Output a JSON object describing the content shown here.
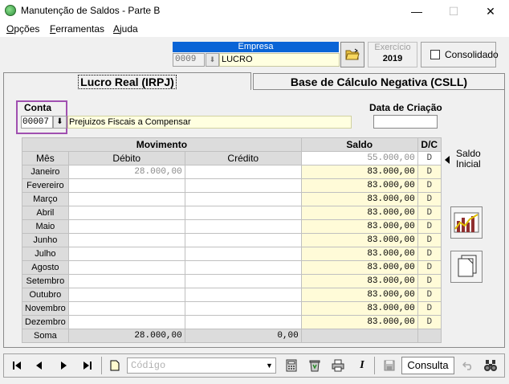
{
  "window": {
    "title": "Manutenção de Saldos - Parte B",
    "minimize": "—",
    "maximize": "☐",
    "close": "✕"
  },
  "menu": [
    {
      "first": "O",
      "rest": "pções"
    },
    {
      "first": "F",
      "rest": "erramentas"
    },
    {
      "first": "A",
      "rest": "juda"
    }
  ],
  "empresa": {
    "header": "Empresa",
    "code": "0009",
    "name": "LUCRO"
  },
  "exercicio": {
    "label": "Exercício",
    "value": "2019"
  },
  "consolidado": {
    "label": "Consolidado",
    "checked": false
  },
  "tabs": {
    "active": "Lucro Real (IRPJ)",
    "inactive": "Base de Cálculo Negativa (CSLL)"
  },
  "conta": {
    "label": "Conta",
    "code": "00007",
    "description": "Prejuizos Fiscais a Compensar"
  },
  "data_criacao": {
    "label": "Data de Criação",
    "value": ""
  },
  "table": {
    "headers": {
      "movimento": "Movimento",
      "saldo": "Saldo",
      "dc": "D/C",
      "mes": "Mês",
      "debito": "Débito",
      "credito": "Crédito"
    },
    "initial": {
      "debito": "",
      "credito": "",
      "saldo": "55.000,00",
      "dc": "D"
    },
    "rows": [
      {
        "mes": "Janeiro",
        "debito": "28.000,00",
        "credito": "",
        "saldo": "83.000,00",
        "dc": "D"
      },
      {
        "mes": "Fevereiro",
        "debito": "",
        "credito": "",
        "saldo": "83.000,00",
        "dc": "D"
      },
      {
        "mes": "Março",
        "debito": "",
        "credito": "",
        "saldo": "83.000,00",
        "dc": "D"
      },
      {
        "mes": "Abril",
        "debito": "",
        "credito": "",
        "saldo": "83.000,00",
        "dc": "D"
      },
      {
        "mes": "Maio",
        "debito": "",
        "credito": "",
        "saldo": "83.000,00",
        "dc": "D"
      },
      {
        "mes": "Junho",
        "debito": "",
        "credito": "",
        "saldo": "83.000,00",
        "dc": "D"
      },
      {
        "mes": "Julho",
        "debito": "",
        "credito": "",
        "saldo": "83.000,00",
        "dc": "D"
      },
      {
        "mes": "Agosto",
        "debito": "",
        "credito": "",
        "saldo": "83.000,00",
        "dc": "D"
      },
      {
        "mes": "Setembro",
        "debito": "",
        "credito": "",
        "saldo": "83.000,00",
        "dc": "D"
      },
      {
        "mes": "Outubro",
        "debito": "",
        "credito": "",
        "saldo": "83.000,00",
        "dc": "D"
      },
      {
        "mes": "Novembro",
        "debito": "",
        "credito": "",
        "saldo": "83.000,00",
        "dc": "D"
      },
      {
        "mes": "Dezembro",
        "debito": "",
        "credito": "",
        "saldo": "83.000,00",
        "dc": "D"
      }
    ],
    "soma": {
      "label": "Soma",
      "debito": "28.000,00",
      "credito": "0,00"
    }
  },
  "saldo_inicial": {
    "line1": "Saldo",
    "line2": "Inicial"
  },
  "toolbar": {
    "codigo_placeholder": "Código",
    "consulta": "Consulta"
  },
  "icons": [
    "first-icon",
    "prev-icon",
    "next-icon",
    "last-icon",
    "new-doc-icon",
    "dropdown-icon",
    "calculator-icon",
    "recycle-bin-icon",
    "printer-icon",
    "italic-icon",
    "save-icon",
    "undo-icon",
    "binoculars-icon",
    "chart-icon",
    "pages-icon",
    "folder-open-icon"
  ]
}
